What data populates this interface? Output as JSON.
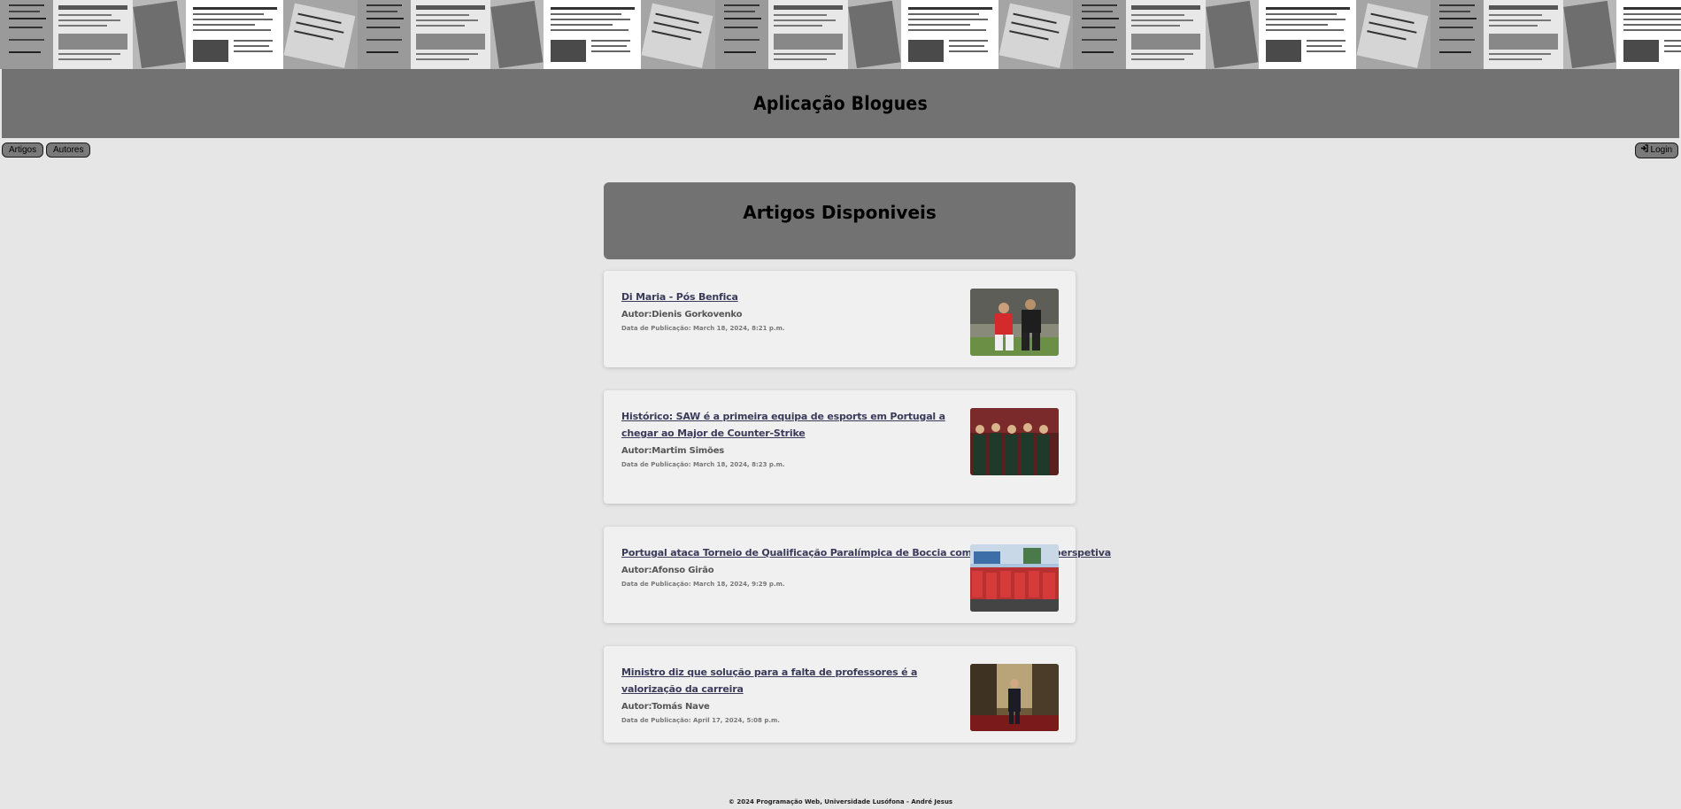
{
  "header": {
    "title": "Aplicação Blogues"
  },
  "nav": {
    "artigos": "Artigos",
    "autores": "Autores",
    "login": "Login",
    "login_icon": "sign-in-icon"
  },
  "main": {
    "heading": "Artigos Disponiveis",
    "articles": [
      {
        "title": "Di Maria - Pós Benfica",
        "author": "Autor:Dienis Gorkovenko",
        "date": "Data de Publicação: March 18, 2024, 8:21 p.m."
      },
      {
        "title": "Histórico: SAW é a primeira equipa de esports em Portugal a chegar ao Major de Counter-Strike",
        "author": "Autor:Martim Simões",
        "date": "Data de Publicação: March 18, 2024, 8:23 p.m."
      },
      {
        "title": "Portugal ataca Torneio de Qualificação Paralímpica de Boccia com Paris 2024 em perspetiva",
        "author": "Autor:Afonso Girão",
        "date": "Data de Publicação: March 18, 2024, 9:29 p.m."
      },
      {
        "title": "Ministro diz que solução para a falta de professores é a valorização da carreira",
        "author": "Autor:Tomás Nave",
        "date": "Data de Publicação: April 17, 2024, 5:08 p.m."
      }
    ]
  },
  "footer": {
    "text": "© 2024 Programação Web, Universidade Lusófona - André Jesus"
  },
  "colors": {
    "background": "#e6e6e6",
    "title_bar": "#727272",
    "card": "#f0f0f0",
    "link": "#3a3a5a"
  }
}
